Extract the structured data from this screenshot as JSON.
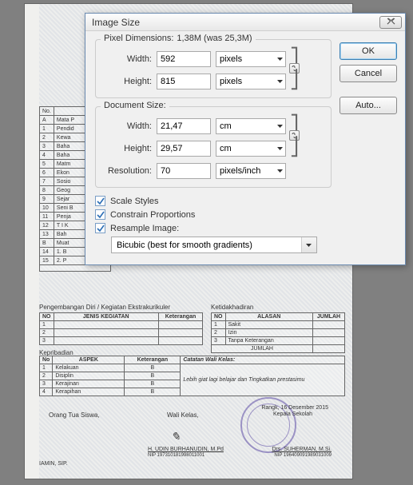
{
  "dialog": {
    "title": "Image Size",
    "buttons": {
      "ok": "OK",
      "cancel": "Cancel",
      "auto": "Auto..."
    },
    "pixel": {
      "legend": "Pixel Dimensions:",
      "summary": "1,38M (was 25,3M)",
      "width_label": "Width:",
      "width_value": "592",
      "height_label": "Height:",
      "height_value": "815",
      "unit": "pixels"
    },
    "doc": {
      "legend": "Document Size:",
      "width_label": "Width:",
      "width_value": "21,47",
      "height_label": "Height:",
      "height_value": "29,57",
      "unit": "cm",
      "res_label": "Resolution:",
      "res_value": "70",
      "res_unit": "pixels/inch"
    },
    "checks": {
      "scale": "Scale Styles",
      "constrain": "Constrain Proportions",
      "resample": "Resample Image:"
    },
    "resample_method": "Bicubic (best for smooth gradients)"
  },
  "document": {
    "subjects": {
      "col_no": "No.",
      "items": [
        {
          "no": "A",
          "name": "Mata P"
        },
        {
          "no": "1",
          "name": "Pendid"
        },
        {
          "no": "2",
          "name": "Kewa"
        },
        {
          "no": "3",
          "name": "Baha"
        },
        {
          "no": "4",
          "name": "Baha"
        },
        {
          "no": "5",
          "name": "Matm"
        },
        {
          "no": "6",
          "name": "Ekon"
        },
        {
          "no": "7",
          "name": "Sosio"
        },
        {
          "no": "8",
          "name": "Geog"
        },
        {
          "no": "9",
          "name": "Sejar"
        },
        {
          "no": "10",
          "name": "Seni B"
        },
        {
          "no": "11",
          "name": "Penja"
        },
        {
          "no": "12",
          "name": "T I K"
        },
        {
          "no": "13",
          "name": "Bah"
        },
        {
          "no": "B",
          "name": "Muat"
        },
        {
          "no": "14",
          "name": "1. B"
        },
        {
          "no": "15",
          "name": "2. P"
        }
      ]
    },
    "extracurricular": {
      "title": "Pengembangan Diri / Kegiatan Ekstrakurikuler",
      "headers": [
        "NO",
        "JENIS KEGIATAN",
        "Keterangan"
      ]
    },
    "absence": {
      "title": "Ketidakhadiran",
      "headers": [
        "NO",
        "ALASAN",
        "JUMLAH"
      ],
      "rows": [
        "Sakit",
        "Izin",
        "Tanpa Keterangan"
      ],
      "total": "JUMLAH"
    },
    "kepribadian": {
      "title": "Kepribadian",
      "headers": [
        "No",
        "ASPEK",
        "Keterangan"
      ],
      "note_title": "Catatan Wali Kelas:",
      "note": "Lebih giat lagi belajar dan Tingkatkan prestasimu",
      "rows": [
        {
          "no": "1",
          "aspek": "Kelakuan",
          "ket": "B"
        },
        {
          "no": "2",
          "aspek": "Disiplin",
          "ket": "B"
        },
        {
          "no": "3",
          "aspek": "Kerajinan",
          "ket": "B"
        },
        {
          "no": "4",
          "aspek": "Kerapihan",
          "ket": "B"
        }
      ]
    },
    "signatures": {
      "left": "Orang Tua Siswa,",
      "middle_role": "Wali Kelas,",
      "middle_name": "H. UDIN BURHANUDIN, M.Pd",
      "middle_nip": "NIP 197310181998011001",
      "right_date": "Rangk, 16 Desember 2015",
      "right_role": "Kepala Sekolah",
      "right_name": "Drs. SUHERMAN, M.Si.",
      "right_nip": "NIP 196409091989031009",
      "footer_name": "IAMIN, SIP."
    }
  }
}
